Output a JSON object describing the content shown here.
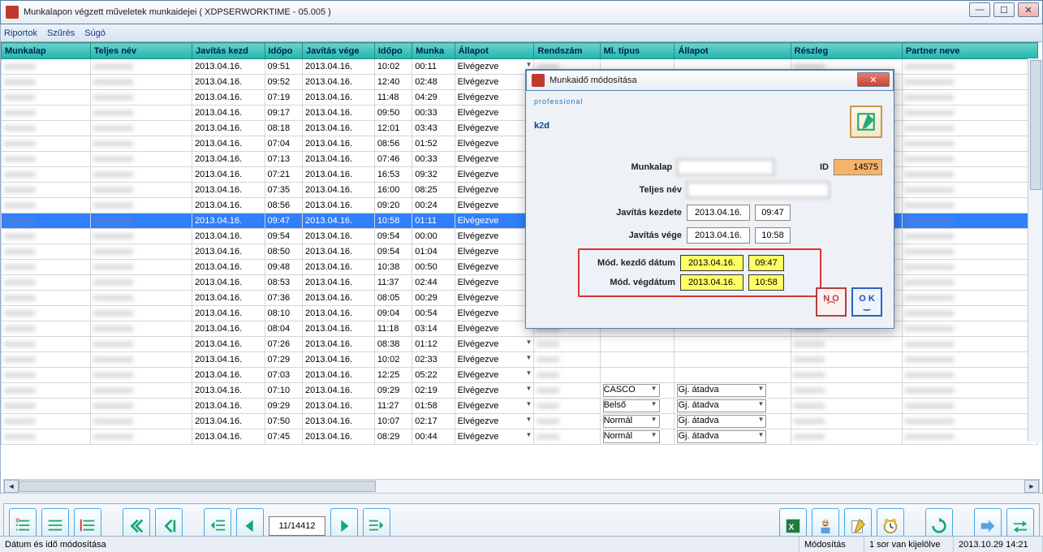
{
  "window": {
    "title": "Munkalapon végzett műveletek munkaidejei ( XDPSERWORKTIME - 05.005 )",
    "min": "—",
    "max": "☐",
    "close": "✕"
  },
  "menu": {
    "riportok": "Riportok",
    "szures": "Szűrés",
    "sugo": "Súgó"
  },
  "columns": {
    "c0": "Munkalap",
    "c1": "Teljes név",
    "c2": "Javítás kezd",
    "c3": "Időpo",
    "c4": "Javítás vége",
    "c5": "Időpo",
    "c6": "Munka",
    "c7": "Állapot",
    "c8": "Rendszám",
    "c9": "Ml. típus",
    "c10": "Állapot",
    "c11": "Részleg",
    "c12": "Partner neve"
  },
  "rows": [
    {
      "d1": "2013.04.16.",
      "t1": "09:51",
      "d2": "2013.04.16.",
      "t2": "10:02",
      "dur": "00:11",
      "st": "Elvégezve"
    },
    {
      "d1": "2013.04.16.",
      "t1": "09:52",
      "d2": "2013.04.16.",
      "t2": "12:40",
      "dur": "02:48",
      "st": "Elvégezve"
    },
    {
      "d1": "2013.04.16.",
      "t1": "07:19",
      "d2": "2013.04.16.",
      "t2": "11:48",
      "dur": "04:29",
      "st": "Elvégezve"
    },
    {
      "d1": "2013.04.16.",
      "t1": "09:17",
      "d2": "2013.04.16.",
      "t2": "09:50",
      "dur": "00:33",
      "st": "Elvégezve"
    },
    {
      "d1": "2013.04.16.",
      "t1": "08:18",
      "d2": "2013.04.16.",
      "t2": "12:01",
      "dur": "03:43",
      "st": "Elvégezve"
    },
    {
      "d1": "2013.04.16.",
      "t1": "07:04",
      "d2": "2013.04.16.",
      "t2": "08:56",
      "dur": "01:52",
      "st": "Elvégezve"
    },
    {
      "d1": "2013.04.16.",
      "t1": "07:13",
      "d2": "2013.04.16.",
      "t2": "07:46",
      "dur": "00:33",
      "st": "Elvégezve"
    },
    {
      "d1": "2013.04.16.",
      "t1": "07:21",
      "d2": "2013.04.16.",
      "t2": "16:53",
      "dur": "09:32",
      "st": "Elvégezve"
    },
    {
      "d1": "2013.04.16.",
      "t1": "07:35",
      "d2": "2013.04.16.",
      "t2": "16:00",
      "dur": "08:25",
      "st": "Elvégezve"
    },
    {
      "d1": "2013.04.16.",
      "t1": "08:56",
      "d2": "2013.04.16.",
      "t2": "09:20",
      "dur": "00:24",
      "st": "Elvégezve"
    },
    {
      "d1": "2013.04.16.",
      "t1": "09:47",
      "d2": "2013.04.16.",
      "t2": "10:58",
      "dur": "01:11",
      "st": "Elvégezve",
      "sel": true
    },
    {
      "d1": "2013.04.16.",
      "t1": "09:54",
      "d2": "2013.04.16.",
      "t2": "09:54",
      "dur": "00:00",
      "st": "Elvégezve"
    },
    {
      "d1": "2013.04.16.",
      "t1": "08:50",
      "d2": "2013.04.16.",
      "t2": "09:54",
      "dur": "01:04",
      "st": "Elvégezve"
    },
    {
      "d1": "2013.04.16.",
      "t1": "09:48",
      "d2": "2013.04.16.",
      "t2": "10:38",
      "dur": "00:50",
      "st": "Elvégezve"
    },
    {
      "d1": "2013.04.16.",
      "t1": "08:53",
      "d2": "2013.04.16.",
      "t2": "11:37",
      "dur": "02:44",
      "st": "Elvégezve"
    },
    {
      "d1": "2013.04.16.",
      "t1": "07:36",
      "d2": "2013.04.16.",
      "t2": "08:05",
      "dur": "00:29",
      "st": "Elvégezve"
    },
    {
      "d1": "2013.04.16.",
      "t1": "08:10",
      "d2": "2013.04.16.",
      "t2": "09:04",
      "dur": "00:54",
      "st": "Elvégezve"
    },
    {
      "d1": "2013.04.16.",
      "t1": "08:04",
      "d2": "2013.04.16.",
      "t2": "11:18",
      "dur": "03:14",
      "st": "Elvégezve"
    },
    {
      "d1": "2013.04.16.",
      "t1": "07:26",
      "d2": "2013.04.16.",
      "t2": "08:38",
      "dur": "01:12",
      "st": "Elvégezve"
    },
    {
      "d1": "2013.04.16.",
      "t1": "07:29",
      "d2": "2013.04.16.",
      "t2": "10:02",
      "dur": "02:33",
      "st": "Elvégezve"
    },
    {
      "d1": "2013.04.16.",
      "t1": "07:03",
      "d2": "2013.04.16.",
      "t2": "12:25",
      "dur": "05:22",
      "st": "Elvégezve"
    },
    {
      "d1": "2013.04.16.",
      "t1": "07:10",
      "d2": "2013.04.16.",
      "t2": "09:29",
      "dur": "02:19",
      "st": "Elvégezve",
      "m": "CASCO",
      "al": "Gj. átadva"
    },
    {
      "d1": "2013.04.16.",
      "t1": "09:29",
      "d2": "2013.04.16.",
      "t2": "11:27",
      "dur": "01:58",
      "st": "Elvégezve",
      "m": "Belső",
      "al": "Gj. átadva"
    },
    {
      "d1": "2013.04.16.",
      "t1": "07:50",
      "d2": "2013.04.16.",
      "t2": "10:07",
      "dur": "02:17",
      "st": "Elvégezve",
      "m": "Normál",
      "al": "Gj. átadva"
    },
    {
      "d1": "2013.04.16.",
      "t1": "07:45",
      "d2": "2013.04.16.",
      "t2": "08:29",
      "dur": "00:44",
      "st": "Elvégezve",
      "m": "Normál",
      "al": "Gj. átadva"
    }
  ],
  "pager": "11/14412",
  "status": {
    "left": "Dátum és idő módosítása",
    "mode": "Módosítás",
    "sel": "1 sor van kijelölve",
    "dt": "2013.10.29 14:21"
  },
  "dialog": {
    "title": "Munkaidő módosítása",
    "logo_prof": "professional",
    "logo_k": "k",
    "logo_2": "2",
    "logo_d": "d",
    "lbl_munkalap": "Munkalap",
    "lbl_id": "ID",
    "id_val": "14575",
    "lbl_nev": "Teljes név",
    "lbl_kezd": "Javítás kezdete",
    "kezd_d": "2013.04.16.",
    "kezd_t": "09:47",
    "lbl_vege": "Javítás vége",
    "vege_d": "2013.04.16.",
    "vege_t": "10:58",
    "lbl_mod_kezd": "Mód. kezdő dátum",
    "mk_d": "2013.04.16.",
    "mk_t": "09:47",
    "lbl_mod_vege": "Mód. végdátum",
    "mv_d": "2013.04.16.",
    "mv_t": "10:58",
    "no": "N O",
    "ok": "O K"
  }
}
